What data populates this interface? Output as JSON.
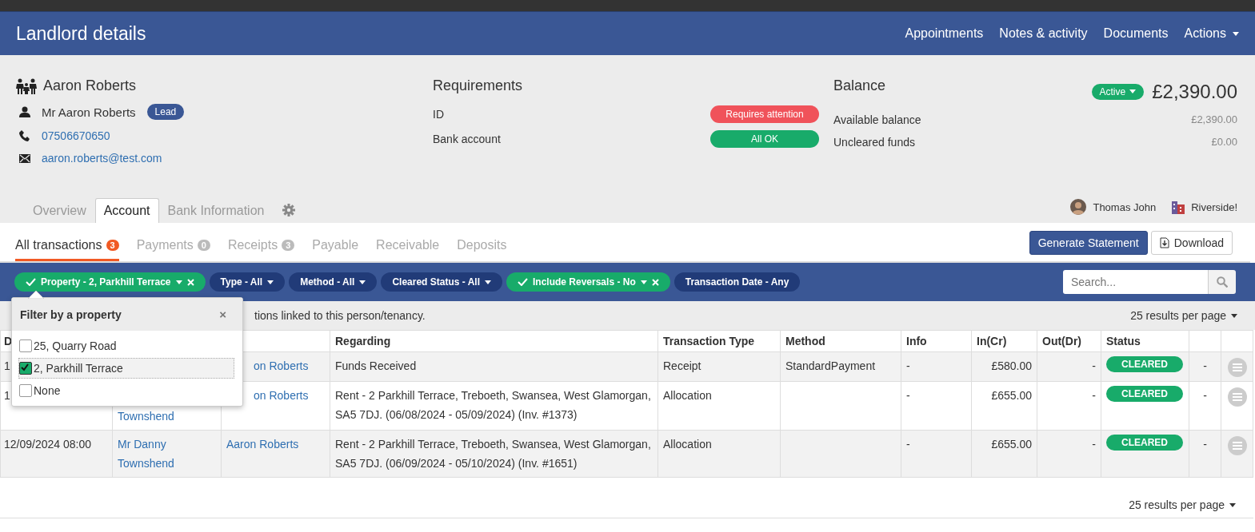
{
  "header": {
    "title": "Landlord details",
    "nav": [
      {
        "label": "Appointments",
        "dropdown": false
      },
      {
        "label": "Notes & activity",
        "dropdown": false
      },
      {
        "label": "Documents",
        "dropdown": false
      },
      {
        "label": "Actions",
        "dropdown": true
      }
    ]
  },
  "contact": {
    "name": "Aaron Roberts",
    "person": "Mr Aaron Roberts",
    "badge": "Lead",
    "phone": "07506670650",
    "email": "aaron.roberts@test.com"
  },
  "requirements": {
    "title": "Requirements",
    "items": [
      {
        "label": "ID",
        "status": "Requires attention",
        "ok": false
      },
      {
        "label": "Bank account",
        "status": "All OK",
        "ok": true
      }
    ]
  },
  "balance": {
    "title": "Balance",
    "state": "Active",
    "amount": "£2,390.00",
    "items": [
      {
        "label": "Available balance",
        "value": "£2,390.00"
      },
      {
        "label": "Uncleared funds",
        "value": "£0.00"
      }
    ]
  },
  "tabs": [
    {
      "label": "Overview",
      "selected": false
    },
    {
      "label": "Account",
      "selected": true
    },
    {
      "label": "Bank Information",
      "selected": false
    }
  ],
  "assignees": [
    {
      "kind": "user",
      "label": "Thomas John"
    },
    {
      "kind": "branch",
      "label": "Riverside!"
    }
  ],
  "subtabs": [
    {
      "label": "All transactions",
      "count": "3",
      "selected": true
    },
    {
      "label": "Payments",
      "count": "0",
      "selected": false
    },
    {
      "label": "Receipts",
      "count": "3",
      "selected": false
    },
    {
      "label": "Payable",
      "selected": false
    },
    {
      "label": "Receivable",
      "selected": false
    },
    {
      "label": "Deposits",
      "selected": false
    }
  ],
  "actions": [
    {
      "label": "Generate Statement",
      "kind": "primary"
    },
    {
      "label": "Download",
      "kind": "download"
    }
  ],
  "filters": [
    {
      "label": "Property - 2, Parkhill Terrace",
      "active": true,
      "dropdown": true
    },
    {
      "label": "Type - All",
      "active": false,
      "dropdown": true
    },
    {
      "label": "Method - All",
      "active": false,
      "dropdown": true
    },
    {
      "label": "Cleared Status - All",
      "active": false,
      "dropdown": true
    },
    {
      "label": "Include Reversals - No",
      "active": true,
      "dropdown": true
    },
    {
      "label": "Transaction Date - Any",
      "active": false,
      "dropdown": false
    }
  ],
  "search": {
    "placeholder": "Search..."
  },
  "info": {
    "text": "tions linked to this person/tenancy.",
    "covered": true
  },
  "per_page": "25 results per page",
  "popup": {
    "title": "Filter by a property",
    "close": "×",
    "options": [
      {
        "label": "25, Quarry Road",
        "checked": false
      },
      {
        "label": "2, Parkhill Terrace",
        "checked": true
      },
      {
        "label": "None",
        "checked": false
      }
    ]
  },
  "table": {
    "columns": [
      "D",
      "",
      "",
      "Regarding",
      "Transaction Type",
      "Method",
      "Info",
      "In(Cr)",
      "Out(Dr)",
      "Status",
      "",
      ""
    ],
    "rows": [
      {
        "date": {
          "text": "1"
        },
        "person": {
          "text": "on Roberts",
          "covered": true
        },
        "regarding": "Funds Received",
        "type": "Receipt",
        "method": "StandardPayment",
        "info": "-",
        "in": "£580.00",
        "out": "-",
        "status": "CLEARED",
        "extra": "-"
      },
      {
        "date": {
          "text": "1"
        },
        "created_by": {
          "text": "Townshend",
          "covered": true
        },
        "person": {
          "text": "on Roberts",
          "covered": true
        },
        "regarding": "Rent - 2 Parkhill Terrace, Treboeth, Swansea, West Glamorgan, SA5 7DJ. (06/08/2024 - 05/09/2024) (Inv. #1373)",
        "type": "Allocation",
        "info": "-",
        "in": "£655.00",
        "out": "-",
        "status": "CLEARED",
        "extra": "-"
      },
      {
        "date": {
          "text": "12/09/2024 08:00"
        },
        "created_by": {
          "text": "Mr Danny Townshend"
        },
        "person": {
          "text": "Aaron Roberts"
        },
        "regarding": "Rent - 2 Parkhill Terrace, Treboeth, Swansea, West Glamorgan, SA5 7DJ. (06/09/2024 - 05/10/2024) (Inv. #1651)",
        "type": "Allocation",
        "info": "-",
        "in": "£655.00",
        "out": "-",
        "status": "CLEARED",
        "extra": "-"
      }
    ]
  },
  "footer_per_page": "25 results per page"
}
